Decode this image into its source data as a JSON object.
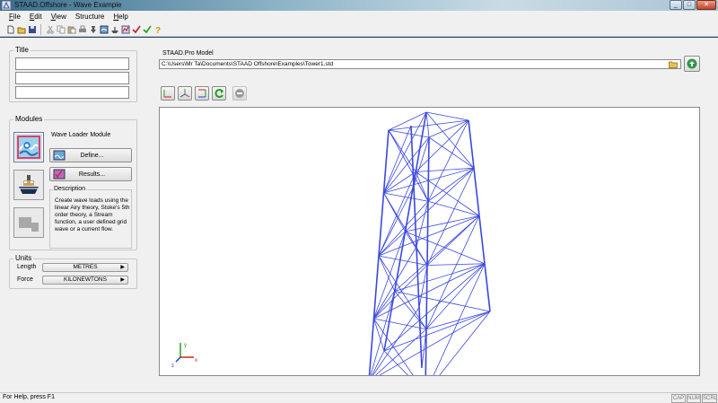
{
  "window": {
    "title": "STAAD.Offshore - Wave Example"
  },
  "menu": [
    {
      "key": "F",
      "rest": "ile"
    },
    {
      "key": "E",
      "rest": "dit"
    },
    {
      "key": "V",
      "rest": "iew"
    },
    {
      "key": "",
      "rest": "Structure"
    },
    {
      "key": "H",
      "rest": "elp"
    }
  ],
  "toolbar": {
    "icons": [
      "new-file-icon",
      "open-folder-icon",
      "save-icon",
      "cut-icon",
      "copy-icon",
      "paste-icon",
      "print-icon",
      "pin-icon",
      "module-icon",
      "ship-icon",
      "analysis-icon",
      "check-icon",
      "check-green-icon",
      "help-icon"
    ]
  },
  "title_group": {
    "label": "Title",
    "lines": [
      "",
      "",
      ""
    ]
  },
  "modules": {
    "label": "Modules",
    "current_module": "Wave Loader Module",
    "define_label": "Define...",
    "results_label": "Results...",
    "description_label": "Description",
    "description_text": "Create wave loads using the linear Airy theory, Stoke's 5th order theory, a Stream function, a user defined grid wave or a current flow."
  },
  "units": {
    "label": "Units",
    "length_label": "Length",
    "length_value": "METRES",
    "force_label": "Force",
    "force_value": "KILONEWTONS"
  },
  "model": {
    "label": "STAAD.Pro Model",
    "path": "C:\\Users\\Mr Ta\\Documents\\STAAD Offshore\\Examples\\Tower1.std"
  },
  "viewport": {
    "axis_x": "x",
    "axis_y": "y",
    "axis_z": "z",
    "structure_color": "#3a48e0"
  },
  "status": {
    "text": "For Help, press F1",
    "cap": "CAP",
    "num": "NUM",
    "scrl": "SCRL"
  }
}
